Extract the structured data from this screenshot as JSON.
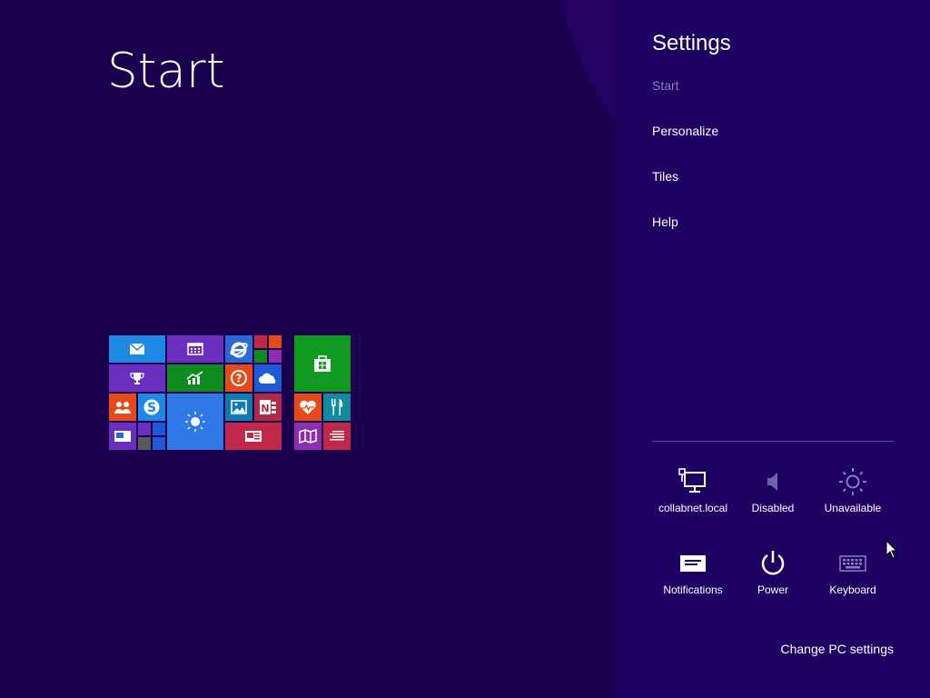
{
  "start": {
    "title": "Start",
    "tiles": [
      {
        "name": "mail-tile",
        "icon": "mail-icon",
        "color": "#1e88e5"
      },
      {
        "name": "calendar-tile",
        "icon": "calendar-icon",
        "color": "#6b2fc0"
      },
      {
        "name": "internet-explorer-tile",
        "icon": "internet-explorer-icon",
        "color": "#2a6ad8"
      },
      {
        "name": "people-tile",
        "icon": "people-icon",
        "color": "#e64a19"
      },
      {
        "name": "skype-tile",
        "icon": "skype-icon",
        "color": "#1e88e5"
      },
      {
        "name": "games-tile",
        "icon": "trophy-icon",
        "color": "#6b2fc0"
      },
      {
        "name": "finance-tile",
        "icon": "chart-icon",
        "color": "#0f8b1f"
      },
      {
        "name": "help-tile",
        "icon": "help-icon",
        "color": "#e64a19"
      },
      {
        "name": "onedrive-tile",
        "icon": "cloud-icon",
        "color": "#1e5ad8"
      },
      {
        "name": "weather-tile",
        "icon": "sun-icon",
        "color": "#2f78e8"
      },
      {
        "name": "photos-tile",
        "icon": "photo-icon",
        "color": "#0f7bb0"
      },
      {
        "name": "onenote-tile",
        "icon": "onenote-icon",
        "color": "#b0284a"
      },
      {
        "name": "news-tile",
        "icon": "news-icon",
        "color": "#c0284a"
      },
      {
        "name": "desktop-tile",
        "icon": "desktop-icon",
        "color": "#6b2fc0"
      },
      {
        "name": "store-tile",
        "icon": "store-icon",
        "color": "#0f9b1f"
      },
      {
        "name": "health-tile",
        "icon": "heart-icon",
        "color": "#e64a19"
      },
      {
        "name": "food-tile",
        "icon": "food-icon",
        "color": "#0f8b9b"
      },
      {
        "name": "maps-tile",
        "icon": "map-icon",
        "color": "#8b2fb0"
      },
      {
        "name": "reading-list-tile",
        "icon": "list-icon",
        "color": "#c0284a"
      }
    ]
  },
  "settings": {
    "title": "Settings",
    "menu": [
      {
        "label": "Start",
        "state": "dim"
      },
      {
        "label": "Personalize"
      },
      {
        "label": "Tiles"
      },
      {
        "label": "Help"
      }
    ],
    "quick": {
      "network": {
        "label": "collabnet.local",
        "icon": "network-icon"
      },
      "volume": {
        "label": "Disabled",
        "icon": "speaker-icon"
      },
      "brightness": {
        "label": "Unavailable",
        "icon": "brightness-icon"
      },
      "notifications": {
        "label": "Notifications",
        "icon": "notifications-icon"
      },
      "power": {
        "label": "Power",
        "icon": "power-icon"
      },
      "keyboard": {
        "label": "Keyboard",
        "icon": "keyboard-icon"
      }
    },
    "change_pc_settings": "Change PC settings"
  },
  "colors": {
    "start_bg": "#1b0050",
    "charm_bg": "#1d0062",
    "dim_text": "#8b7fc0"
  }
}
